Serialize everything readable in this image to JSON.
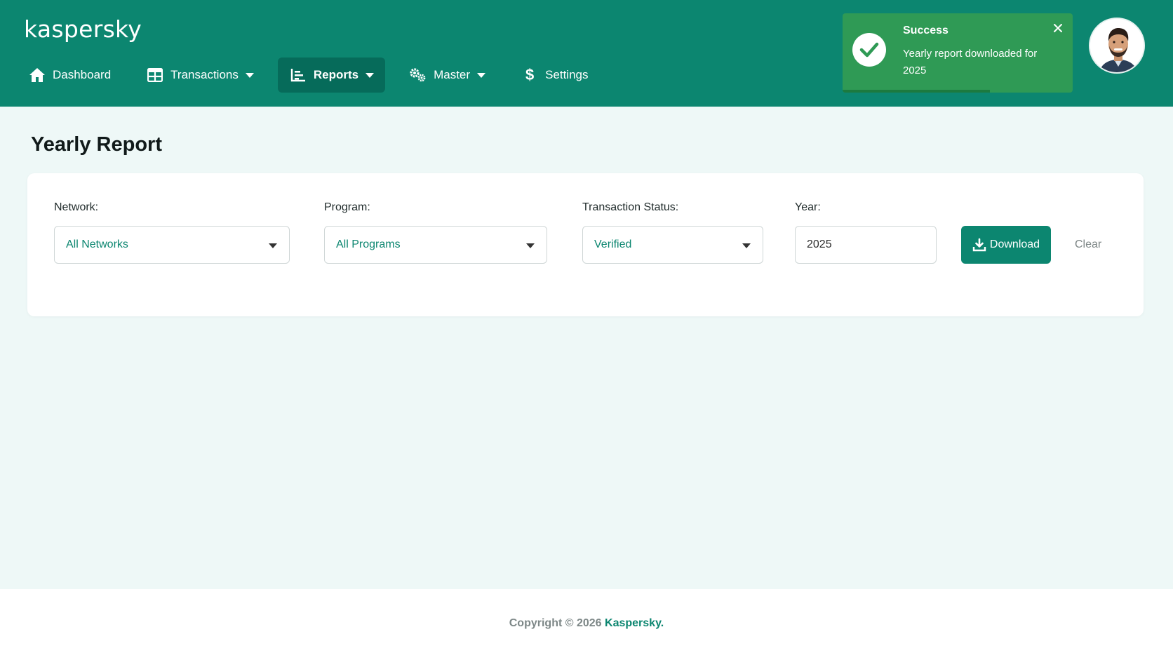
{
  "header": {
    "brand": "kaspersky",
    "nav": [
      {
        "label": "Dashboard",
        "icon": "home-icon",
        "dropdown": false,
        "active": false
      },
      {
        "label": "Transactions",
        "icon": "table-icon",
        "dropdown": true,
        "active": false
      },
      {
        "label": "Reports",
        "icon": "chart-icon",
        "dropdown": true,
        "active": true
      },
      {
        "label": "Master",
        "icon": "gears-icon",
        "dropdown": true,
        "active": false
      },
      {
        "label": "Settings",
        "icon": "dollar-icon",
        "dropdown": false,
        "active": false
      }
    ]
  },
  "toast": {
    "title": "Success",
    "message": "Yearly report downloaded for 2025",
    "progress": 0.64
  },
  "page": {
    "title": "Yearly Report"
  },
  "filters": {
    "network": {
      "label": "Network:",
      "value": "All Networks"
    },
    "program": {
      "label": "Program:",
      "value": "All Programs"
    },
    "status": {
      "label": "Transaction Status:",
      "value": "Verified"
    },
    "year": {
      "label": "Year:",
      "value": "2025"
    },
    "download_label": "Download",
    "clear_label": "Clear"
  },
  "footer": {
    "copyright": "Copyright © 2026",
    "brand": "Kaspersky."
  },
  "colors": {
    "primary": "#0c8670",
    "toast": "#2f9a55",
    "background": "#eef8f7"
  }
}
